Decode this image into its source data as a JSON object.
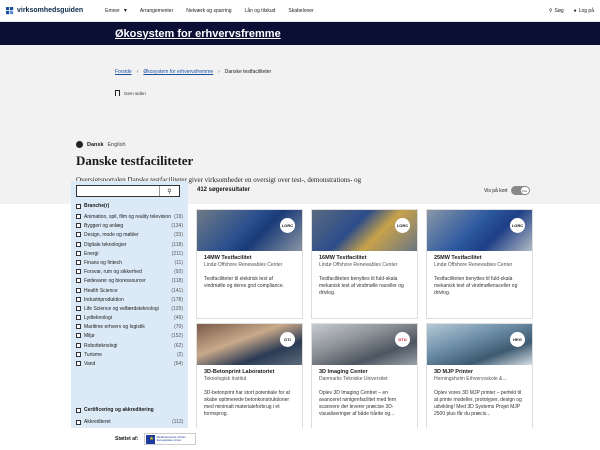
{
  "nav": {
    "logo": "virksomhedsguiden",
    "links": [
      "Emner",
      "Arrangementer",
      "Netværk og sparring",
      "Lån og tilskud",
      "Skabeloner"
    ],
    "search": "Søg",
    "login": "Log på"
  },
  "banner": {
    "title": "Økosystem for erhvervsfremme"
  },
  "breadcrumb": [
    "Forside",
    "Økosystem for erhvervsfremme",
    "Danske testfaciliteter"
  ],
  "save_label": "Gem siden",
  "lang": {
    "current": "Dansk",
    "other": "English"
  },
  "page": {
    "title": "Danske testfaciliteter",
    "intro": "Oversigtsportalen Danske testfaciliteter giver virksomheder en oversigt over test-, demonstrations- og udviklingsfaciliteter i hele Danmark."
  },
  "search": {
    "placeholder": ""
  },
  "filters": {
    "branche_label": "Branche(r)",
    "options": [
      {
        "label": "Animation, spil, film og reality television",
        "count": "(19)"
      },
      {
        "label": "Byggeri og anlæg",
        "count": "(134)"
      },
      {
        "label": "Design, mode og møbler",
        "count": "(33)"
      },
      {
        "label": "Digitale teknologier",
        "count": "(118)"
      },
      {
        "label": "Energi",
        "count": "(211)"
      },
      {
        "label": "Finans og fintech",
        "count": "(11)"
      },
      {
        "label": "Forsvar, rum og sikkerhed",
        "count": "(92)"
      },
      {
        "label": "Fødevarer og bioressourcer",
        "count": "(118)"
      },
      {
        "label": "Health Science",
        "count": "(141)"
      },
      {
        "label": "Industriproduktion",
        "count": "(178)"
      },
      {
        "label": "Life Science og velfærdsteknologi",
        "count": "(129)"
      },
      {
        "label": "Lydteknologi",
        "count": "(49)"
      },
      {
        "label": "Maritime erhverv og logistik",
        "count": "(70)"
      },
      {
        "label": "Miljø",
        "count": "(152)"
      },
      {
        "label": "Robotteknologi",
        "count": "(62)"
      },
      {
        "label": "Turisme",
        "count": "(2)"
      },
      {
        "label": "Vand",
        "count": "(64)"
      }
    ],
    "cert_label": "Certificering og akkreditering",
    "akk_label": "Akkrediteret",
    "akk_count": "(112)"
  },
  "results": {
    "count": "412 søgeresultater",
    "map_label": "Vis på kort",
    "toggle": "Fra"
  },
  "cards": [
    {
      "title": "14MW Testfacilitet",
      "org": "Lindø Offshore Renewables Center",
      "desc": "Testfaciliteter til elektrisk test af vindmølle og deres gnd compliance.",
      "badge": "LORC"
    },
    {
      "title": "16MW Testfacilitet",
      "org": "Lindø Offshore Renewables Center",
      "desc": "Testfaciliteten benyttes til fuld-skala mekanisk test af vindmølle naceller og drivlog.",
      "badge": "LORC"
    },
    {
      "title": "25MW Testfacilitet",
      "org": "Lindø Offshore Renewables Center",
      "desc": "Testfaciliteten benyttes til fuld-skala mekanisk test af vindmøllenaceller og drivlog.",
      "badge": "LORC"
    },
    {
      "title": "3D-Betonprint Laboratoriet",
      "org": "Teknologisk Institut",
      "desc": "3D-betonprint har stort potentiale for at skabe optimerede betonkonstruktioner med minimalt materialeforbrug i et formsprog.",
      "badge": "DTI"
    },
    {
      "title": "3D Imaging Center",
      "org": "Danmarks Tekniske Universitet",
      "desc": "Oplev 3D Imaging Centret – en avanceret røntgenfacilitet med fem scannere der leverer præcise 3D-visualiseringer af både hårde og...",
      "badge": "DTU"
    },
    {
      "title": "3D MJP Printer",
      "org": "Herningsholm Erhvervsskole &...",
      "desc": "Oplev vores 3D MJP printer – perfekt til at printe modeller, prototyper, design og udvikling! Med 3D Systems Projet MJP 2500 plus får du præcis...",
      "badge": "HEG"
    }
  ],
  "footer": {
    "support": "Støttet af:",
    "eu_text": "Medfinansieret af Den Europæiske Union"
  }
}
